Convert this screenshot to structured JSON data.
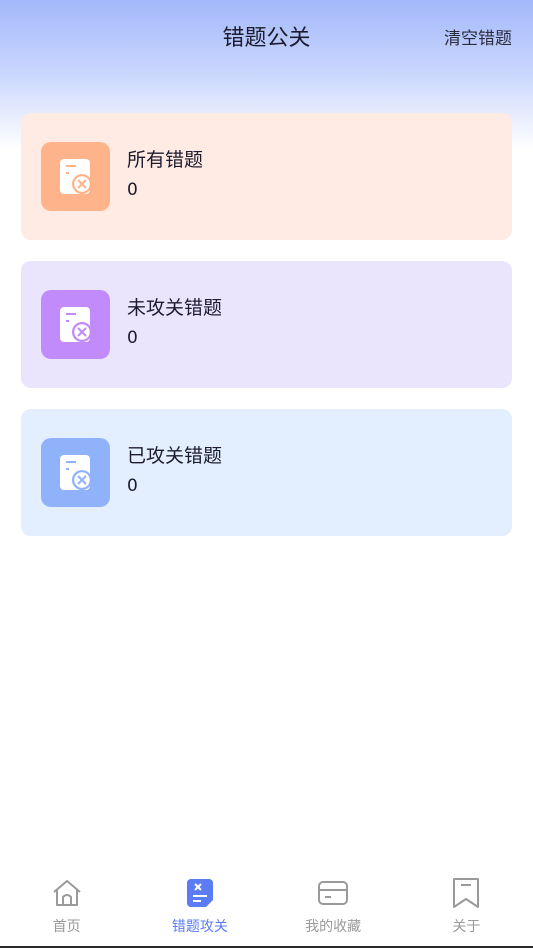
{
  "header": {
    "title": "错题公关",
    "clear_label": "清空错题"
  },
  "cards": [
    {
      "title": "所有错题",
      "count": "0",
      "bg": "#ffebe4",
      "icon_bg": "#ffb38a",
      "icon": "document-x-icon"
    },
    {
      "title": "未攻关错题",
      "count": "0",
      "bg": "#ebe4fd",
      "icon_bg": "#c28bfb",
      "icon": "document-x-icon"
    },
    {
      "title": "已攻关错题",
      "count": "0",
      "bg": "#e3eefe",
      "icon_bg": "#90b2fb",
      "icon": "document-x-icon"
    }
  ],
  "tabbar": {
    "items": [
      {
        "label": "首页",
        "icon": "home-icon",
        "active": false
      },
      {
        "label": "错题攻关",
        "icon": "wrong-questions-icon",
        "active": true
      },
      {
        "label": "我的收藏",
        "icon": "card-icon",
        "active": false
      },
      {
        "label": "关于",
        "icon": "bookmark-icon",
        "active": false
      }
    ]
  },
  "colors": {
    "accent": "#5b7cf2",
    "inactive": "#9a9a9a"
  }
}
